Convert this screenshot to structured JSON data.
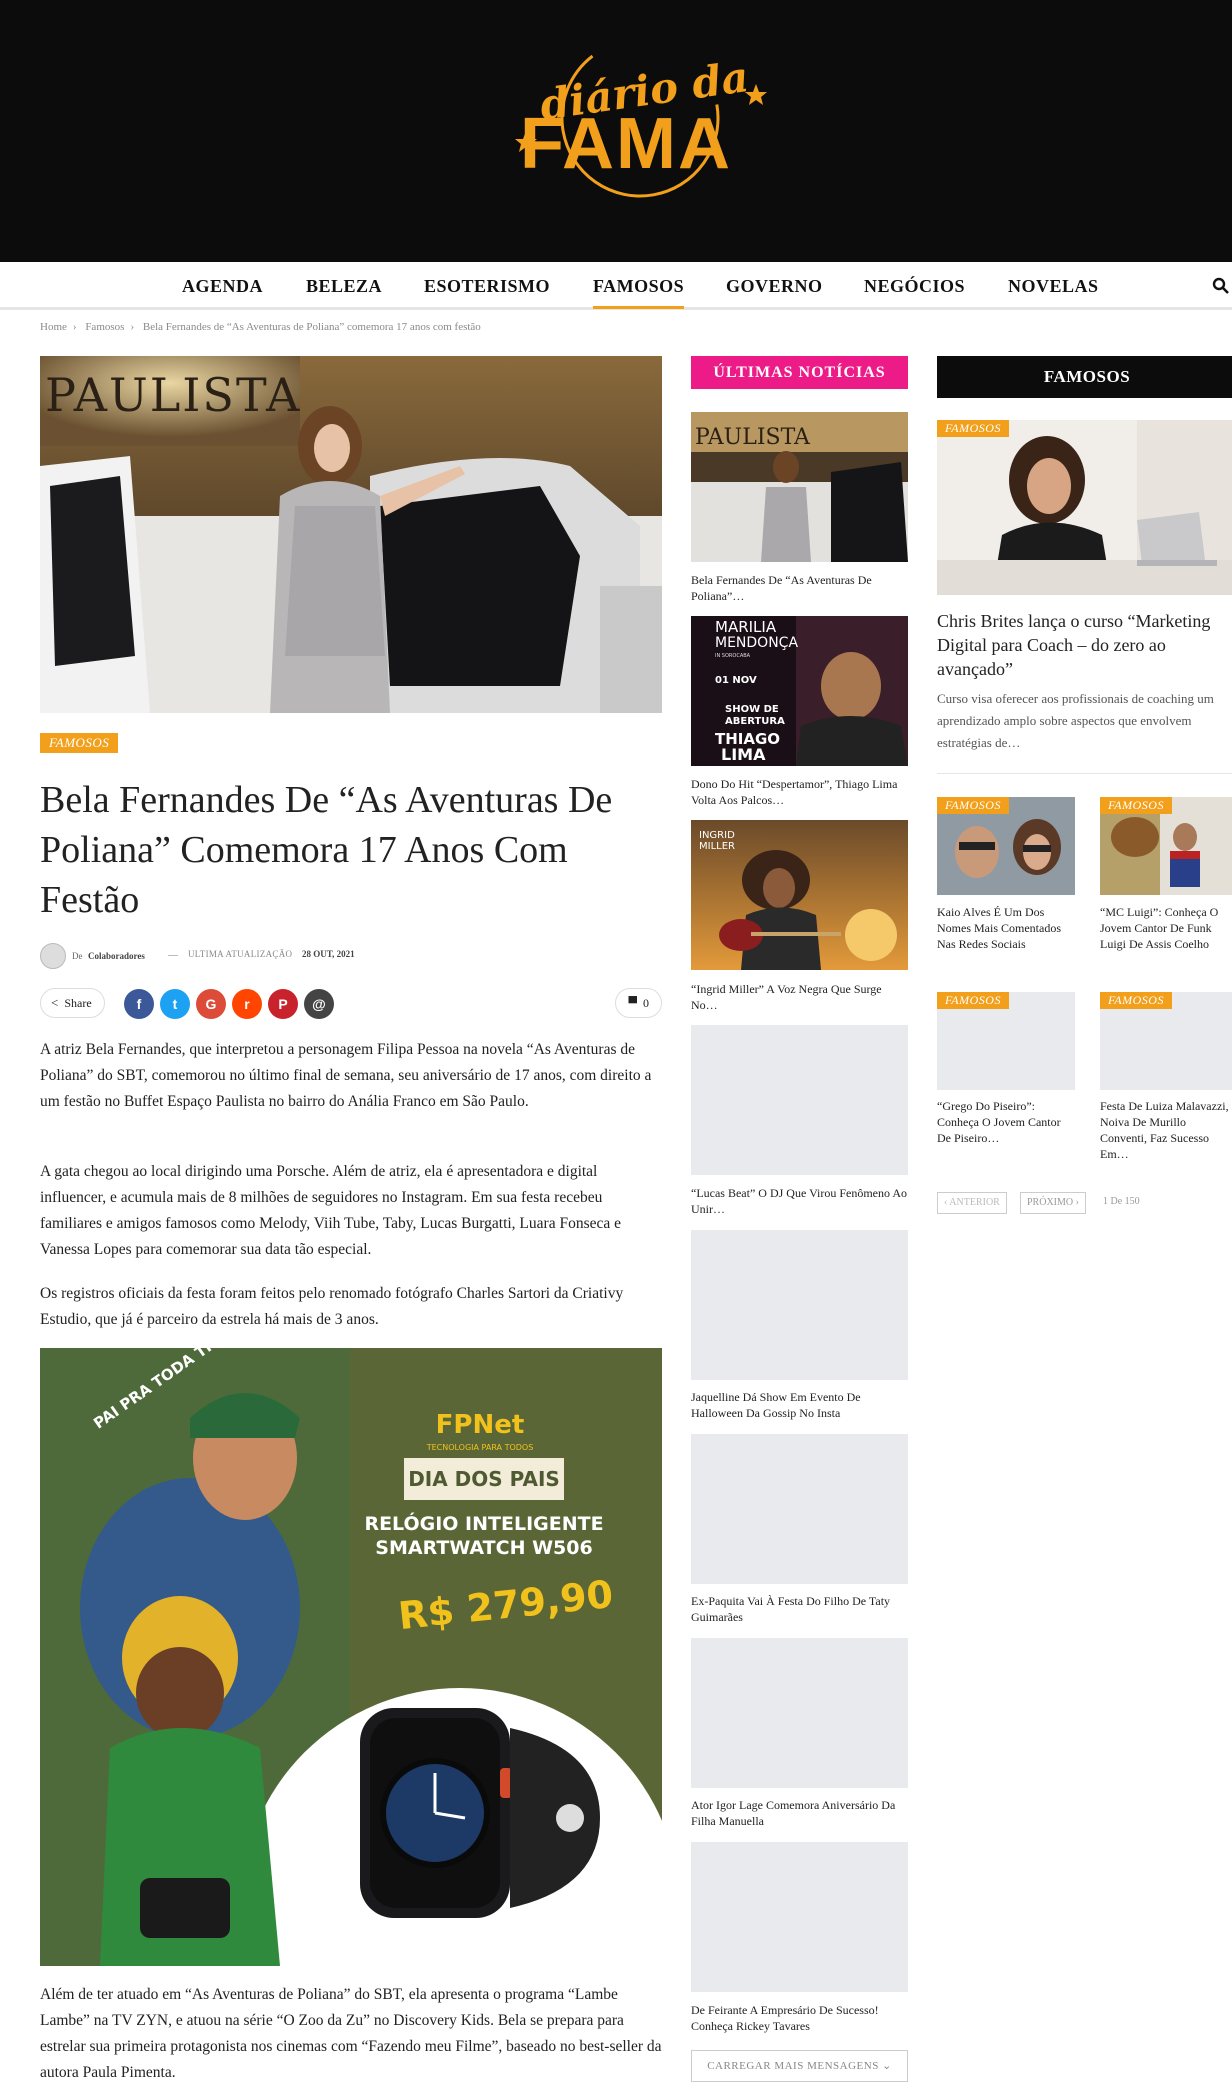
{
  "brand": {
    "logo_line1": "diário da",
    "logo_line2": "FAMA",
    "accent": "#f2a01c",
    "pink": "#ec1b87"
  },
  "nav": {
    "items": [
      "AGENDA",
      "BELEZA",
      "ESOTERISMO",
      "FAMOSOS",
      "GOVERNO",
      "NEGÓCIOS",
      "NOVELAS"
    ],
    "active": "FAMOSOS"
  },
  "breadcrumb": {
    "home": "Home",
    "section": "Famosos",
    "current": "Bela Fernandes de “As Aventuras de Poliana” comemora 17 anos com festão"
  },
  "hero_sign": "PAULISTA",
  "article": {
    "category": "FAMOSOS",
    "title": "Bela Fernandes De “As Aventuras De Poliana” Comemora 17 Anos Com Festão",
    "author_prefix": "De",
    "author": "Colaboradores",
    "updated_label": "ULTIMA ATUALIZAÇÃO",
    "updated_date": "28 OUT, 2021",
    "share_label": "Share",
    "comment_count": "0",
    "paragraphs": [
      "A atriz Bela Fernandes, que interpretou a personagem Filipa Pessoa na novela “As Aventuras de Poliana” do SBT, comemorou no último final de semana, seu aniversário de 17 anos, com direito a um festão no Buffet Espaço Paulista no bairro do Anália Franco em São Paulo.",
      "A gata chegou ao local dirigindo uma Porsche. Além de atriz, ela é apresentadora e digital influencer, e acumula mais de 8 milhões de seguidores no Instagram. Em sua festa recebeu familiares e amigos famosos como Melody, Viih Tube, Taby, Lucas Burgatti, Luara Fonseca e Vanessa Lopes para comemorar sua data tão especial.",
      "Os registros oficiais da festa foram feitos pelo renomado fotógrafo Charles Sartori da Criativy Estudio, que já é parceiro da estrela há mais de 3 anos.",
      "Além de ter atuado em “As Aventuras de Poliana” do SBT, ela apresenta o programa “Lambe Lambe” na TV ZYN, e atuou na série “O Zoo da Zu” no Discovery Kids. Bela se prepara para estrelar sua primeira protagonista nos cinemas com “Fazendo meu Filme”, baseado no best-seller da autora Paula Pimenta."
    ]
  },
  "ad": {
    "badge": "PAI PRA TODA TRILHA",
    "brand": "FPNet",
    "brand_sub": "TECNOLOGIA PARA TODOS",
    "ribbon": "DIA DOS PAIS",
    "product_line1": "RELÓGIO INTELIGENTE",
    "product_line2": "SMARTWATCH W506",
    "price": "R$ 279,90"
  },
  "latest": {
    "heading": "ÚLTIMAS NOTÍCIAS",
    "items": [
      "Bela Fernandes De “As Aventuras De Poliana”…",
      "Dono Do Hit “Despertamor”, Thiago Lima Volta Aos Palcos…",
      "“Ingrid Miller” A Voz Negra Que Surge No…",
      "“Lucas Beat” O DJ Que Virou Fenômeno Ao Unir…",
      "Jaquelline Dá Show Em Evento De Halloween Da Gossip No Insta",
      "Ex-Paquita Vai À Festa Do Filho De Taty Guimarães",
      "Ator Igor Lage Comemora Aniversário Da Filha Manuella",
      "De Feirante A Empresário De Sucesso! Conheça Rickey Tavares"
    ],
    "thumb1_sign": "PAULISTA",
    "thumb2": {
      "name1": "MARILIA",
      "name2": "MENDONÇA",
      "city": "IN SOROCABA",
      "date": "01 NOV",
      "show1": "SHOW DE",
      "show2": "ABERTURA",
      "artist1": "THIAGO",
      "artist2": "LIMA"
    },
    "thumb3": {
      "name1": "INGRID",
      "name2": "MILLER"
    },
    "load_more": "CARREGAR MAIS MENSAGENS"
  },
  "famosos": {
    "heading": "FAMOSOS",
    "featured": {
      "category": "FAMOSOS",
      "title": "Chris Brites lança o curso “Marketing Digital para Coach – do zero ao avançado”",
      "excerpt": "Curso visa oferecer aos profissionais de coaching um aprendizado amplo sobre aspectos que envolvem estratégias de…"
    },
    "grid": [
      {
        "category": "FAMOSOS",
        "title": "Kaio Alves É Um Dos Nomes Mais Comentados Nas Redes Sociais"
      },
      {
        "category": "FAMOSOS",
        "title": "“MC Luigi”: Conheça O Jovem Cantor De Funk Luigi De Assis Coelho"
      },
      {
        "category": "FAMOSOS",
        "title": "“Grego Do Piseiro”: Conheça O Jovem Cantor De Piseiro…"
      },
      {
        "category": "FAMOSOS",
        "title": "Festa De Luiza Malavazzi, Noiva De Murillo Conventi, Faz Sucesso Em…"
      }
    ],
    "pager": {
      "prev": "‹ ANTERIOR",
      "next": "PRÓXIMO ›",
      "status": "1 De 150"
    }
  }
}
